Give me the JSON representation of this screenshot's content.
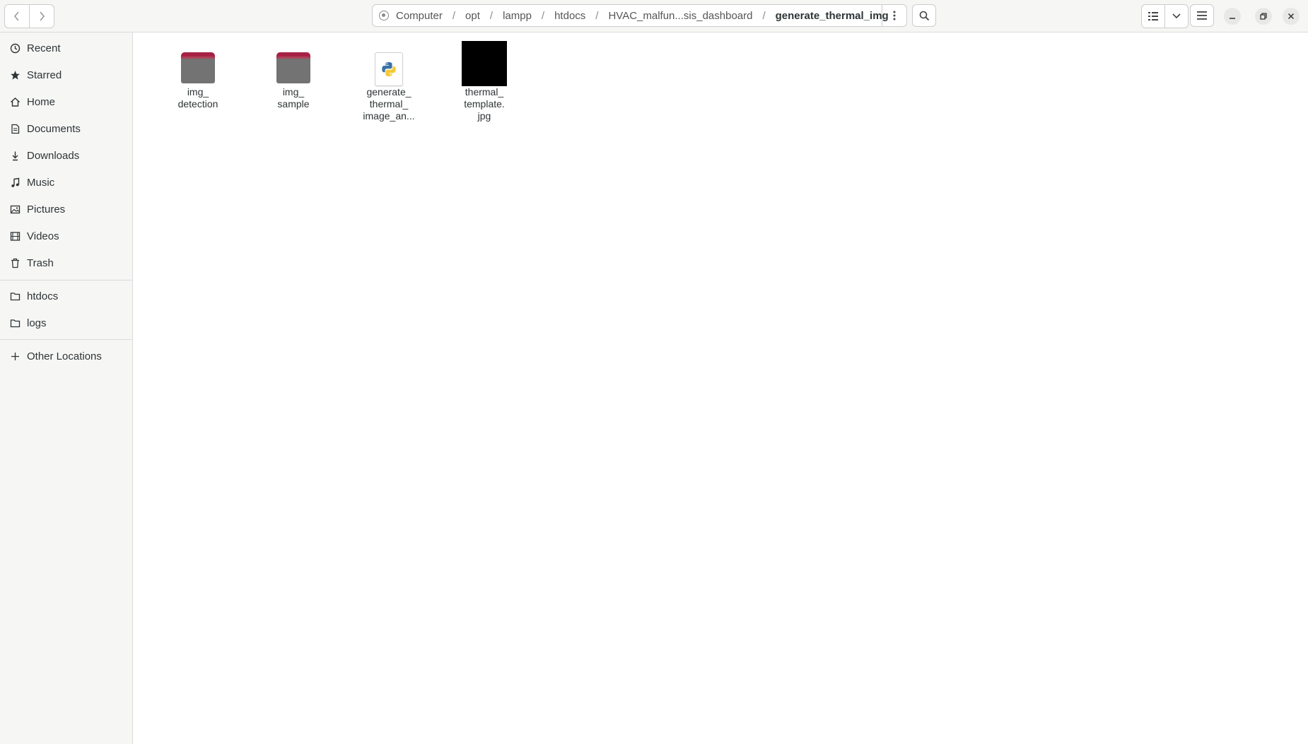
{
  "header": {
    "breadcrumbs": [
      "Computer",
      "opt",
      "lampp",
      "htdocs",
      "HVAC_malfun...sis_dashboard",
      "generate_thermal_img"
    ],
    "separator": "/"
  },
  "sidebar": {
    "places": [
      {
        "label": "Recent",
        "icon": "clock-icon"
      },
      {
        "label": "Starred",
        "icon": "star-icon"
      },
      {
        "label": "Home",
        "icon": "home-icon"
      },
      {
        "label": "Documents",
        "icon": "document-icon"
      },
      {
        "label": "Downloads",
        "icon": "download-icon"
      },
      {
        "label": "Music",
        "icon": "music-icon"
      },
      {
        "label": "Pictures",
        "icon": "picture-icon"
      },
      {
        "label": "Videos",
        "icon": "video-icon"
      },
      {
        "label": "Trash",
        "icon": "trash-icon"
      }
    ],
    "bookmarks": [
      {
        "label": "htdocs",
        "icon": "folder-icon"
      },
      {
        "label": "logs",
        "icon": "folder-icon"
      }
    ],
    "other": {
      "label": "Other Locations",
      "icon": "plus-icon"
    }
  },
  "files": [
    {
      "name": "img_\ndetection",
      "type": "folder"
    },
    {
      "name": "img_\nsample",
      "type": "folder"
    },
    {
      "name": "generate_\nthermal_\nimage_an...",
      "type": "python"
    },
    {
      "name": "thermal_\ntemplate.\njpg",
      "type": "image"
    }
  ],
  "colors": {
    "folder_accent": "#a72145",
    "folder_body": "#737373",
    "header_bg": "#f6f6f5",
    "sidebar_bg": "#f6f6f5"
  }
}
